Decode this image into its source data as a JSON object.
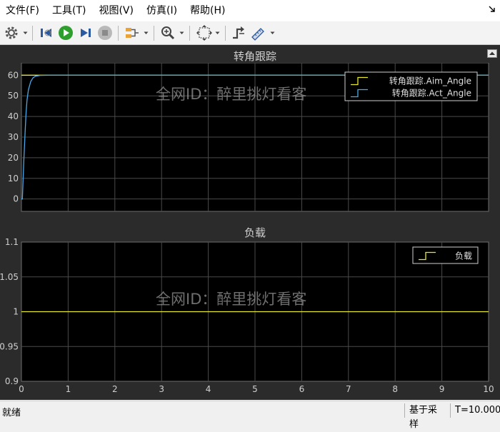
{
  "menu": {
    "items": [
      "文件(F)",
      "工具(T)",
      "视图(V)",
      "仿真(I)",
      "帮助(H)"
    ]
  },
  "toolbar": {
    "icons": [
      "gear-icon",
      "step-back-icon",
      "run-icon",
      "step-forward-icon",
      "stop-icon",
      "signal-config-icon",
      "zoom-icon",
      "fit-to-view-icon",
      "trigger-icon",
      "measure-icon"
    ]
  },
  "watermark": "全网ID：醉里挑灯看客",
  "status": {
    "ready": "就绪",
    "sample_mode": "基于采样",
    "time": "T=10.000"
  },
  "colors": {
    "aim_line": "#e6e62e",
    "act_line": "#4aa8e8",
    "load_line": "#e6e62e",
    "plot_bg": "#000000",
    "scope_bg": "#2b2b2b"
  },
  "chart_data": [
    {
      "type": "line",
      "title": "转角跟踪",
      "xlim": [
        0,
        10
      ],
      "ylim": [
        -6,
        66
      ],
      "yticks": [
        0,
        10,
        20,
        30,
        40,
        50,
        60
      ],
      "ytick_labels": [
        "0",
        "10",
        "20",
        "30",
        "40",
        "50",
        "60"
      ],
      "grid": true,
      "legend_position": "top-right",
      "series": [
        {
          "name": "转角跟踪.Aim_Angle",
          "x": [
            0,
            10
          ],
          "y": [
            60,
            60
          ]
        },
        {
          "name": "转角跟踪.Act_Angle",
          "x": [
            0,
            0.02,
            0.05,
            0.08,
            0.1,
            0.12,
            0.15,
            0.2,
            0.25,
            0.3,
            0.4,
            0.6,
            1.0,
            10
          ],
          "y": [
            0,
            0,
            18,
            33,
            42,
            48,
            53,
            57,
            58.8,
            59.5,
            59.9,
            60,
            60,
            60
          ]
        }
      ]
    },
    {
      "type": "line",
      "title": "负载",
      "xlim": [
        0,
        10
      ],
      "ylim": [
        0.9,
        1.1
      ],
      "yticks": [
        0.9,
        0.95,
        1,
        1.05,
        1.1
      ],
      "ytick_labels": [
        "0.9",
        "0.95",
        "1",
        "1.05",
        "1.1"
      ],
      "xticks": [
        0,
        1,
        2,
        3,
        4,
        5,
        6,
        7,
        8,
        9,
        10
      ],
      "xtick_labels": [
        "0",
        "1",
        "2",
        "3",
        "4",
        "5",
        "6",
        "7",
        "8",
        "9",
        "10"
      ],
      "grid": true,
      "legend_position": "top-right",
      "series": [
        {
          "name": "负载",
          "x": [
            0,
            10
          ],
          "y": [
            1,
            1
          ]
        }
      ]
    }
  ]
}
